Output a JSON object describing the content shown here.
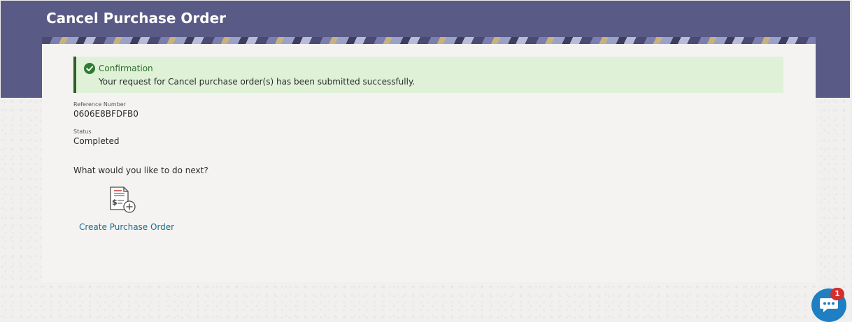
{
  "header": {
    "title": "Cancel Purchase Order"
  },
  "confirmation": {
    "title": "Confirmation",
    "message": "Your request for Cancel purchase order(s) has been submitted successfully."
  },
  "details": [
    {
      "label": "Reference Number",
      "value": "0606E8BFDFB0"
    },
    {
      "label": "Status",
      "value": "Completed"
    }
  ],
  "next_steps": {
    "question": "What would you like to do next?",
    "actions": [
      {
        "label": "Create Purchase Order",
        "icon": "document-dollar-add-icon"
      }
    ]
  },
  "chat": {
    "icon": "chat-bubble-icon",
    "badge_count": "1"
  },
  "colors": {
    "header_bg": "#5a5a86",
    "confirm_bg": "#dff2d8",
    "confirm_accent": "#2e5e26",
    "link": "#1d6b8f",
    "chat_bg": "#1e7fc2",
    "badge_bg": "#d32f2f"
  }
}
